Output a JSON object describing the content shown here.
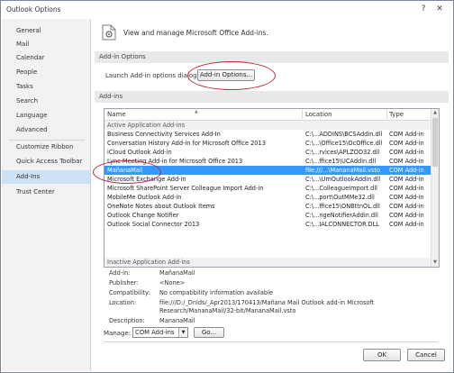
{
  "window": {
    "title": "Outlook Options",
    "help_glyph": "?",
    "close_glyph": "✕"
  },
  "sidebar": {
    "items": [
      {
        "label": "General"
      },
      {
        "label": "Mail"
      },
      {
        "label": "Calendar"
      },
      {
        "label": "People"
      },
      {
        "label": "Tasks"
      },
      {
        "label": "Search"
      },
      {
        "label": "Language"
      },
      {
        "label": "Advanced"
      },
      {
        "label": "Customize Ribbon"
      },
      {
        "label": "Quick Access Toolbar"
      },
      {
        "label": "Add-Ins"
      },
      {
        "label": "Trust Center"
      }
    ],
    "active": "Add-Ins"
  },
  "header": {
    "text": "View and manage Microsoft Office Add-ins."
  },
  "addin_options": {
    "section_title": "Add-in Options",
    "launch_label": "Launch Add-in options dialog:",
    "button_label": "Add-in Options..."
  },
  "addins": {
    "section_title": "Add-ins",
    "columns": {
      "name": "Name",
      "location": "Location",
      "type": "Type",
      "sort_glyph": "▲"
    },
    "active_group": "Active Application Add-ins",
    "rows": [
      {
        "name": "Business Connectivity Services Add-In",
        "location": "C:\\...ADDINS\\BCSAddin.dll",
        "type": "COM Add-in"
      },
      {
        "name": "Conversation History Add-in for Microsoft Office 2013",
        "location": "C:\\...\\Office15\\OcOffice.dll",
        "type": "COM Add-in"
      },
      {
        "name": "iCloud Outlook Add-in",
        "location": "C:\\...rvices\\APLZOD32.dll",
        "type": "COM Add-in"
      },
      {
        "name": "Lync Meeting Add-in for Microsoft Office 2013",
        "location": "C:\\...ffice15\\UCAddin.dll",
        "type": "COM Add-in"
      },
      {
        "name": "MañanaMail",
        "location": "file:///...\\MananaMail.vsto",
        "type": "COM Add-in"
      },
      {
        "name": "Microsoft Exchange Add-in",
        "location": "C:\\...\\UmOutlookAddin.dll",
        "type": "COM Add-in"
      },
      {
        "name": "Microsoft SharePoint Server Colleague Import Add-in",
        "location": "C:\\...ColleagueImport.dll",
        "type": "COM Add-in"
      },
      {
        "name": "MobileMe Outlook Add-in",
        "location": "C:\\...port\\OutMMe32.dll",
        "type": "COM Add-in"
      },
      {
        "name": "OneNote Notes about Outlook Items",
        "location": "C:\\...ffice15\\ONBttnOL.dll",
        "type": "COM Add-in"
      },
      {
        "name": "Outlook Change Notifier",
        "location": "C:\\...ngeNotifierAddin.dll",
        "type": "COM Add-in"
      },
      {
        "name": "Outlook Social Connector 2013",
        "location": "C:\\...IALCONNECTOR.DLL",
        "type": "COM Add-in"
      }
    ],
    "selected_index": 4,
    "inactive_group": "Inactive Application Add-ins",
    "scroll_up": "▲",
    "scroll_down": "▼"
  },
  "details": {
    "addin_label": "Add-in:",
    "addin_value": "MañanaMail",
    "publisher_label": "Publisher:",
    "publisher_value": "<None>",
    "compatibility_label": "Compatibility:",
    "compatibility_value": "No compatibility information available",
    "location_label": "Location:",
    "location_value_1": "file:///D:/_Dnlds/_Apr2013/170413/Mañana Mail Outlook add-in Microsoft",
    "location_value_2": "Research/MananaMail/32-bit/MananaMail.vsto",
    "description_label": "Description:",
    "description_value": "MananaMail"
  },
  "manage": {
    "label": "Manage:",
    "selected": "COM Add-ins",
    "dropdown_glyph": "▼",
    "go_label": "Go..."
  },
  "footer": {
    "ok_label": "OK",
    "cancel_label": "Cancel"
  },
  "colors": {
    "accent_circle": "#c0263b",
    "selection": "#3399ff",
    "sidebar_active": "#cde1f5"
  }
}
